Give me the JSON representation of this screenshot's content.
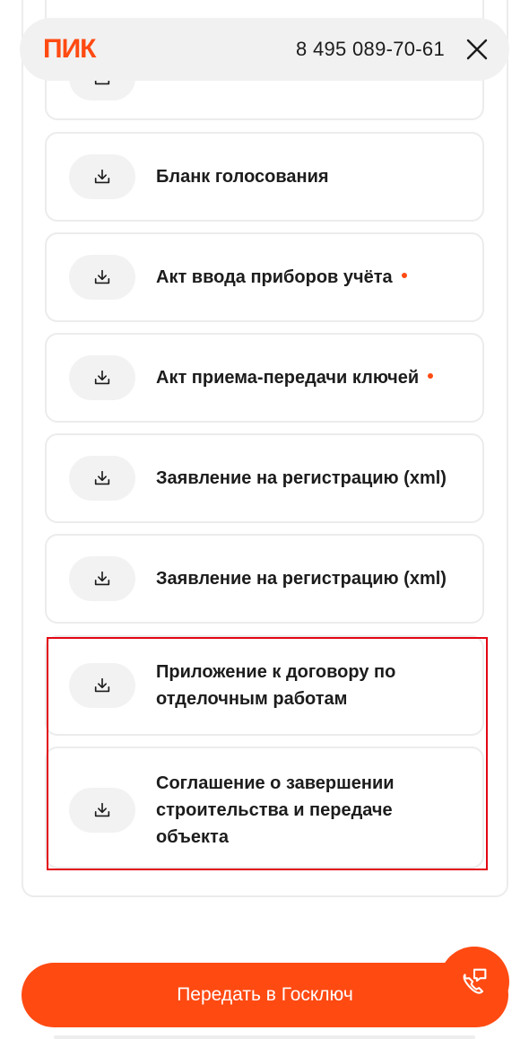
{
  "header": {
    "logo": "ПИК",
    "phone": "8 495 089-70-61",
    "close_icon": "close-icon"
  },
  "documents": [
    {
      "label": "Бланк голосования",
      "required": false
    },
    {
      "label": "Акт ввода приборов учёта",
      "required": true
    },
    {
      "label": "Акт приема-передачи ключей",
      "required": true
    },
    {
      "label": "Заявление на регистрацию (xml)",
      "required": false
    },
    {
      "label": "Заявление на регистрацию (xml)",
      "required": false
    },
    {
      "label_lines": [
        "Приложение к договору по",
        "отделочным работам"
      ],
      "required": false
    },
    {
      "label_lines": [
        "Соглашение о завершении",
        "строительства и передаче",
        "объекта"
      ],
      "required": false
    }
  ],
  "cta": {
    "label": "Передать в Госключ"
  },
  "icons": {
    "download": "download-icon",
    "call": "phone-chat-icon"
  },
  "colors": {
    "accent": "#ff4a12",
    "highlight": "#e30613",
    "button_bg": "#f2f2f2"
  }
}
